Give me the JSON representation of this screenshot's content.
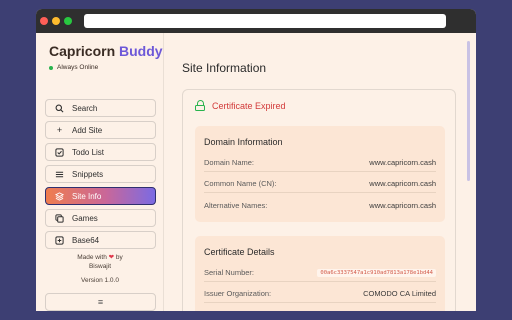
{
  "brand": {
    "name_part1": "Capricorn",
    "name_part2": "Buddy",
    "mascot": "giraffe-icon",
    "status": "Always Online"
  },
  "sidebar": {
    "items": [
      {
        "label": "Search",
        "icon": "search-icon"
      },
      {
        "label": "Add Site",
        "icon": "plus-icon"
      },
      {
        "label": "Todo List",
        "icon": "checkbox-icon"
      },
      {
        "label": "Snippets",
        "icon": "lines-icon"
      },
      {
        "label": "Site Info",
        "icon": "layers-icon",
        "active": true
      },
      {
        "label": "Games",
        "icon": "copy-icon"
      },
      {
        "label": "Base64",
        "icon": "plus-square-icon"
      }
    ],
    "made_with": "Made with",
    "by": "by",
    "author": "Biswajit",
    "version": "Version 1.0.0",
    "menu_icon": "menu-icon"
  },
  "main": {
    "title": "Site Information",
    "certificate_status": "Certificate Expired",
    "domain_info": {
      "title": "Domain Information",
      "rows": [
        {
          "label": "Domain Name:",
          "value": "www.capricorn.cash"
        },
        {
          "label": "Common Name (CN):",
          "value": "www.capricorn.cash"
        },
        {
          "label": "Alternative Names:",
          "value": "www.capricorn.cash"
        }
      ]
    },
    "cert_details": {
      "title": "Certificate Details",
      "rows": [
        {
          "label": "Serial Number:",
          "value": "00a6c3337547a1c910ad7813a178e1bd44"
        },
        {
          "label": "Issuer Organization:",
          "value": "COMODO CA Limited"
        }
      ]
    }
  },
  "colors": {
    "accent_start": "#ef7d4e",
    "accent_end": "#7b6be3",
    "expired": "#d23a3a",
    "online": "#29b34e"
  }
}
